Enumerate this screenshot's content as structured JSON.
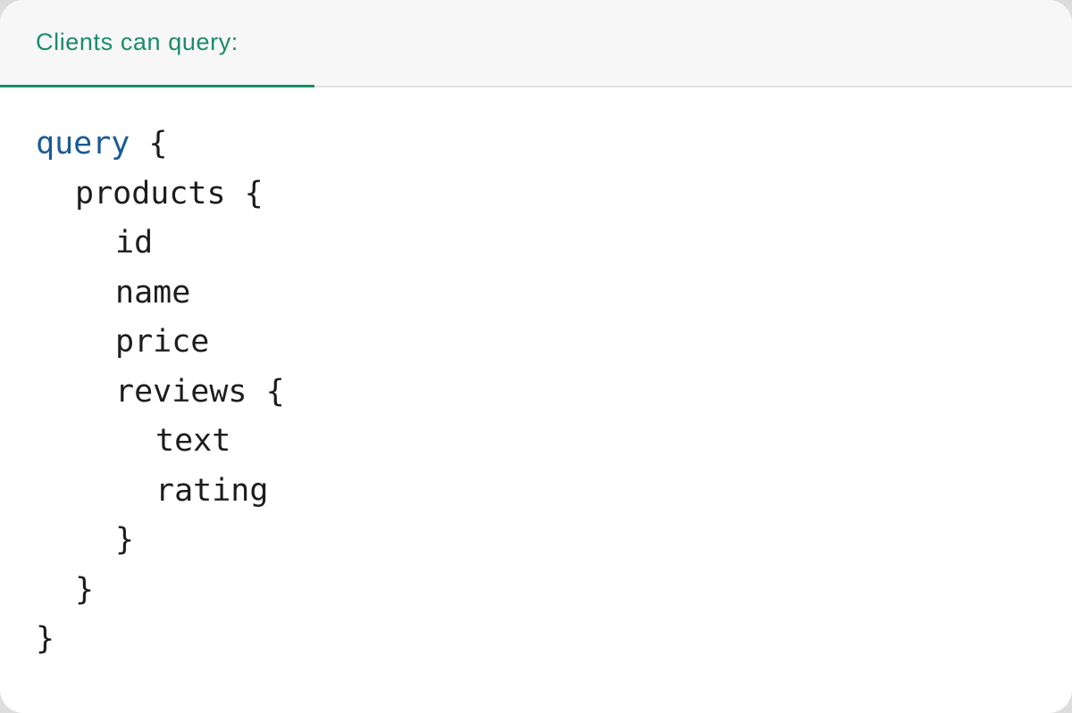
{
  "tab": {
    "label": "Clients can query:"
  },
  "code": {
    "keyword": "query",
    "lines": [
      "query {",
      "products {",
      "id",
      "name",
      "price",
      "reviews {",
      "text",
      "rating",
      "}",
      "}",
      "}"
    ],
    "open_brace": " {"
  },
  "colors": {
    "accent": "#1b8b6b",
    "keyword": "#1a5a96",
    "text": "#1d1d1d"
  }
}
